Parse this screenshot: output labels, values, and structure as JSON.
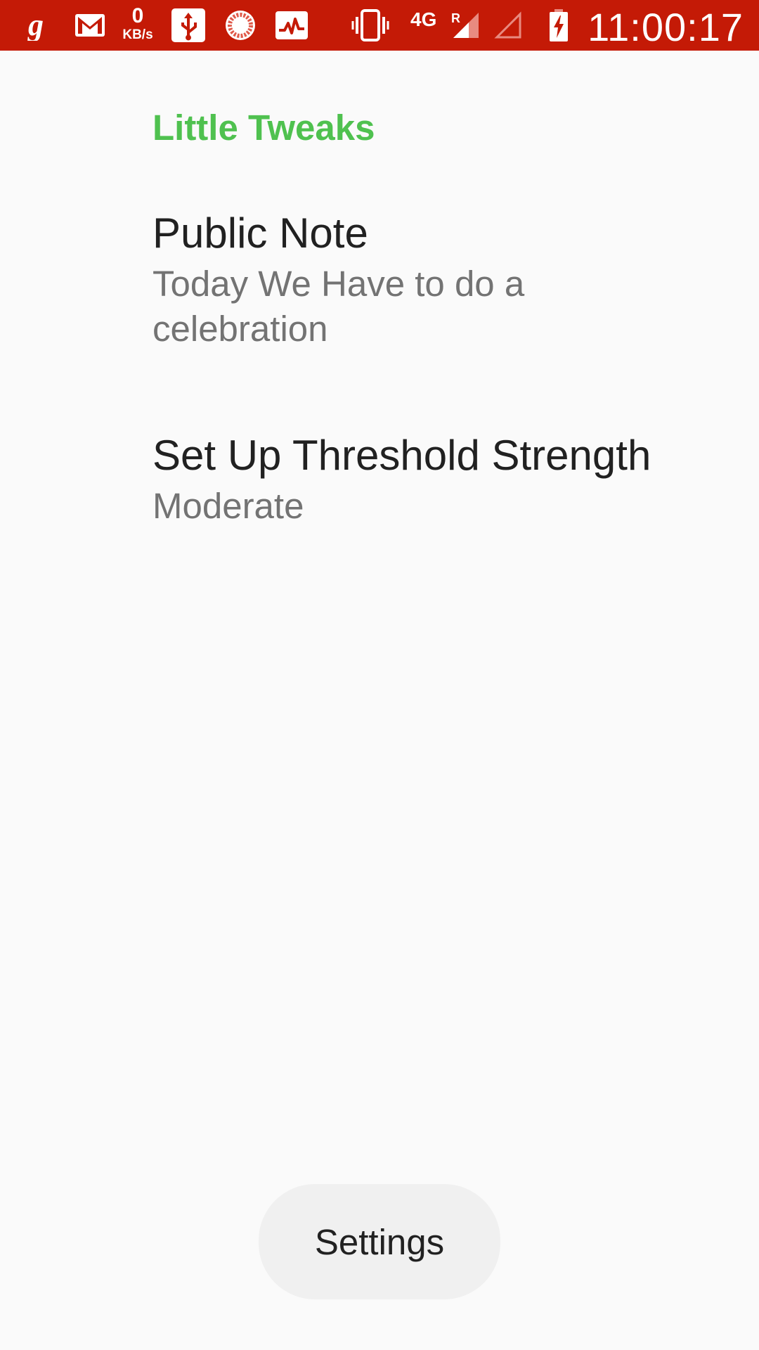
{
  "status_bar": {
    "net_speed_value": "0",
    "net_speed_unit": "KB/s",
    "network_type": "4G",
    "roaming": "R",
    "time": "11:00:17",
    "background_color": "#c41a06",
    "icons": [
      "gaana-icon",
      "gmail-icon",
      "usb-icon",
      "recording-icon",
      "activity-icon",
      "vibrate-icon",
      "signal-icon",
      "signal-empty-icon",
      "battery-charging-icon"
    ]
  },
  "preferences": {
    "category_title": "Little Tweaks",
    "category_color": "#4fc14f",
    "items": [
      {
        "title": "Public Note",
        "summary": "Today We Have to do a celebration"
      },
      {
        "title": "Set Up Threshold Strength",
        "summary": "Moderate"
      }
    ]
  },
  "toast_button": {
    "label": "Settings"
  }
}
